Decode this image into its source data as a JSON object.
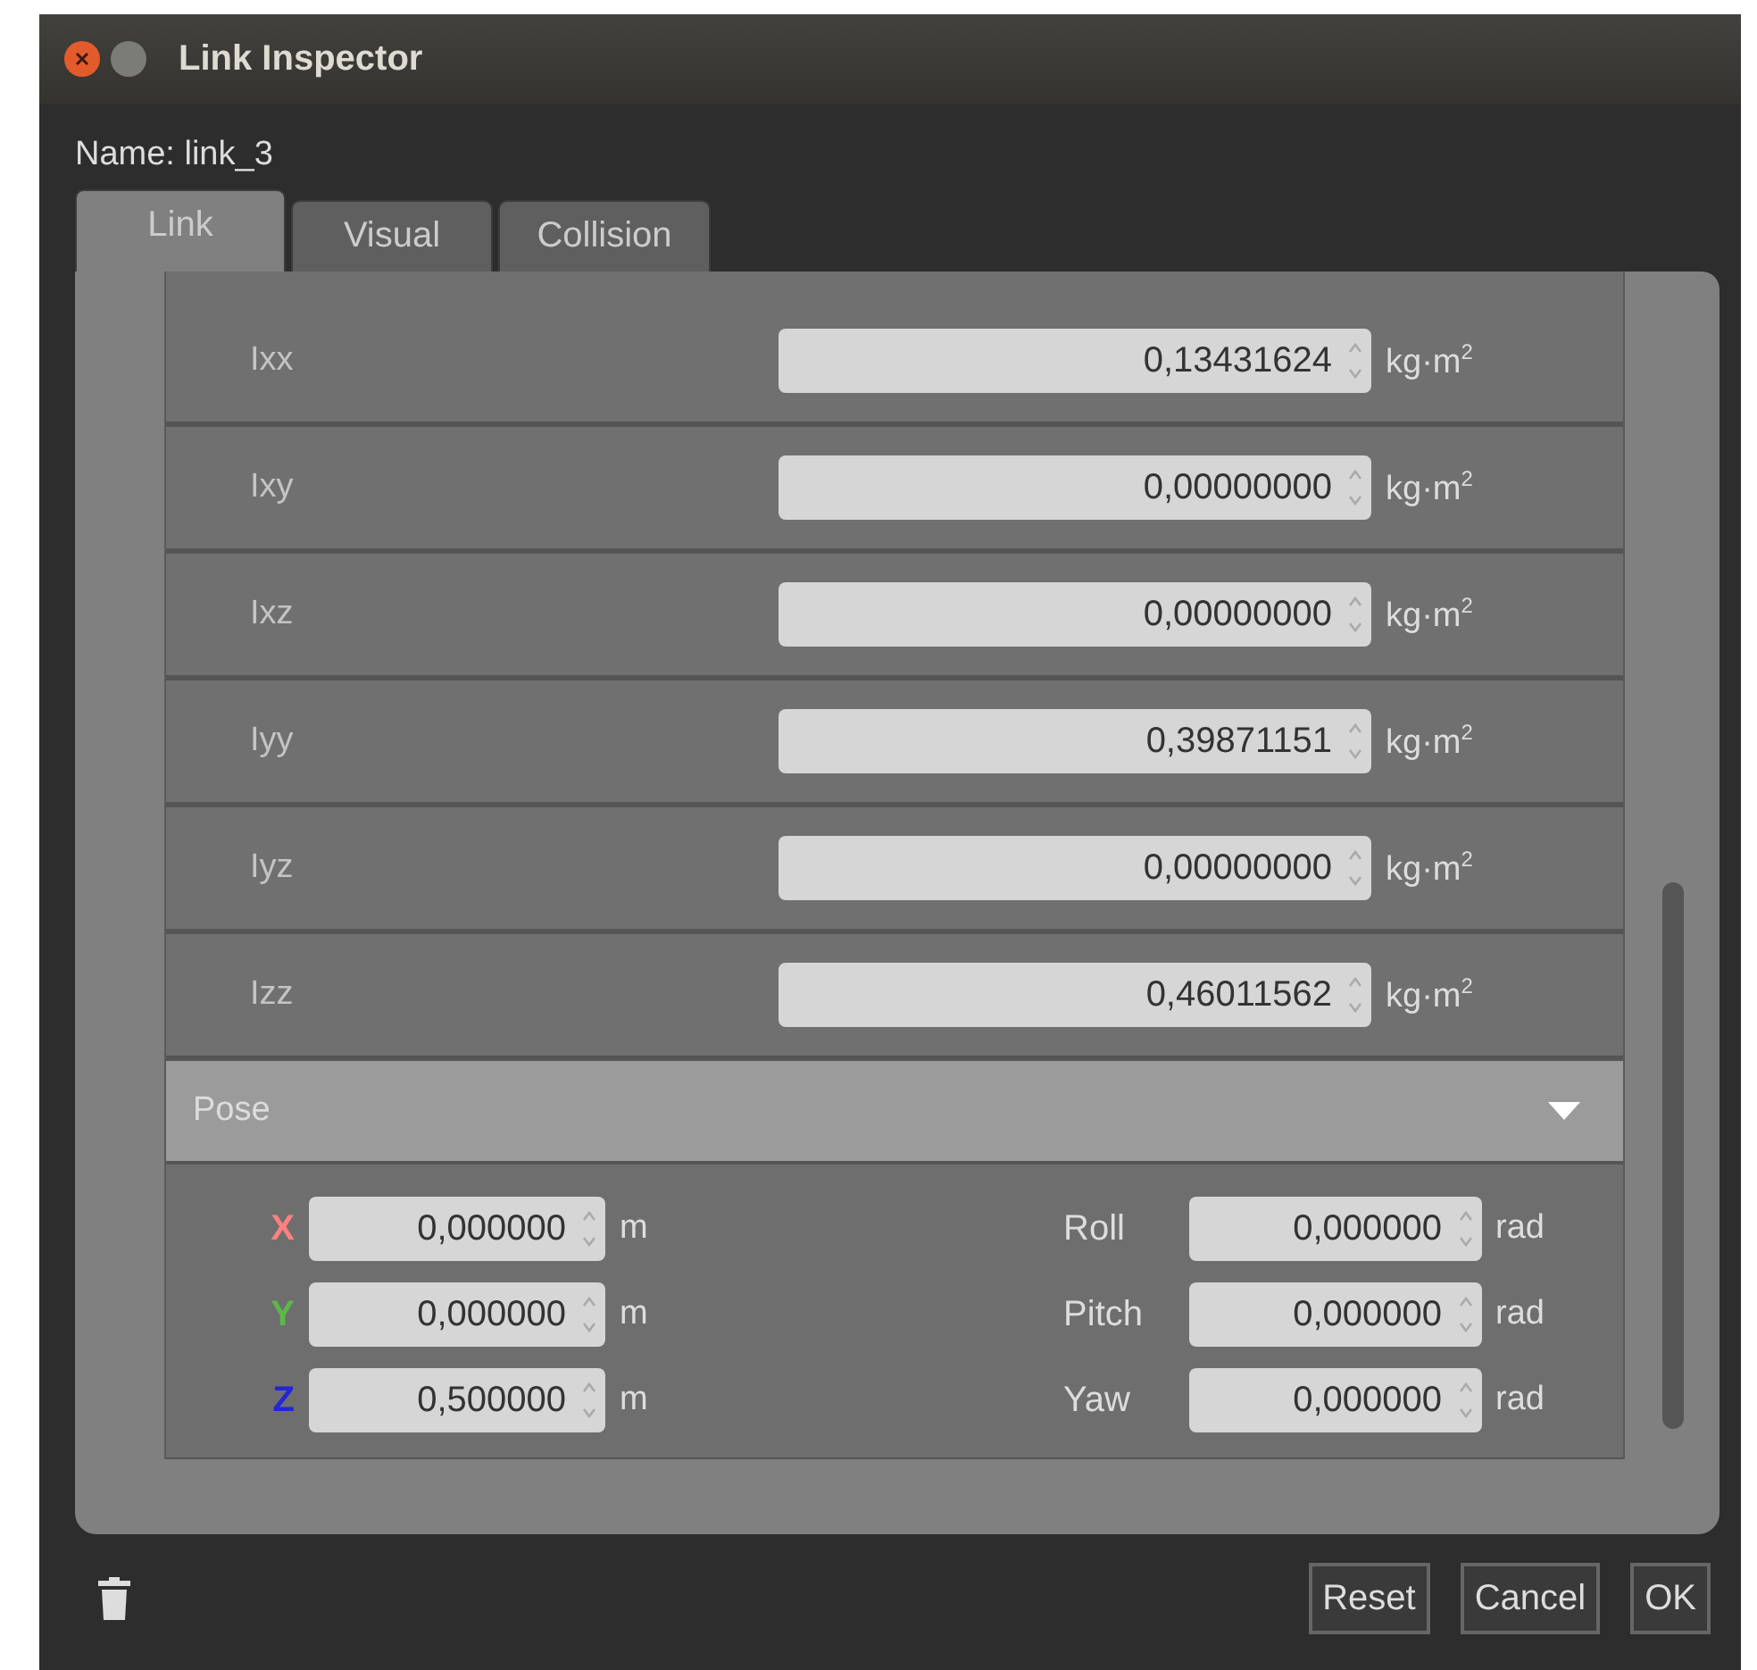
{
  "window": {
    "title": "Link Inspector"
  },
  "name_label": "Name: link_3",
  "tabs": [
    {
      "label": "Link",
      "selected": true
    },
    {
      "label": "Visual",
      "selected": false
    },
    {
      "label": "Collision",
      "selected": false
    }
  ],
  "inertia_rows": [
    {
      "label": "Ixx",
      "value": "0,13431624",
      "unit": "kg·m$^{2}$"
    },
    {
      "label": "Ixy",
      "value": "0,00000000",
      "unit": "kg·m$^{2}$"
    },
    {
      "label": "Ixz",
      "value": "0,00000000",
      "unit": "kg·m$^{2}$"
    },
    {
      "label": "Iyy",
      "value": "0,39871151",
      "unit": "kg·m$^{2}$"
    },
    {
      "label": "Iyz",
      "value": "0,00000000",
      "unit": "kg·m$^{2}$"
    },
    {
      "label": "Izz",
      "value": "0,46011562",
      "unit": "kg·m$^{2}$"
    }
  ],
  "pose": {
    "title": "Pose",
    "expanded": true,
    "position": [
      {
        "axis": "X",
        "color": "#ff8080",
        "value": "0,000000",
        "unit": "m"
      },
      {
        "axis": "Y",
        "color": "#5cb848",
        "value": "0,000000",
        "unit": "m"
      },
      {
        "axis": "Z",
        "color": "#2424d8",
        "value": "0,500000",
        "unit": "m"
      }
    ],
    "rotation": [
      {
        "label": "Roll",
        "value": "0,000000",
        "unit": "rad"
      },
      {
        "label": "Pitch",
        "value": "0,000000",
        "unit": "rad"
      },
      {
        "label": "Yaw",
        "value": "0,000000",
        "unit": "rad"
      }
    ]
  },
  "buttons": [
    "Reset",
    "Cancel",
    "OK"
  ]
}
